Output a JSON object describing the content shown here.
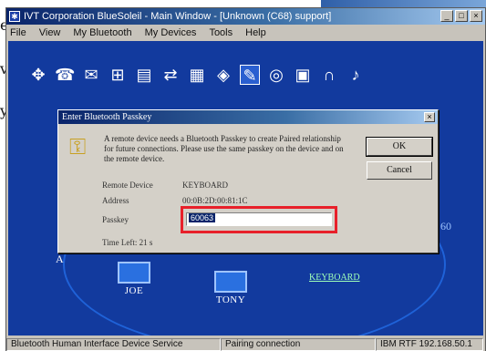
{
  "background": {
    "fragments": [
      "e",
      "vo",
      "y"
    ]
  },
  "window": {
    "title": "IVT Corporation BlueSoleil - Main Window - [Unknown (C68) support]",
    "controls": [
      "_",
      "□",
      "×"
    ],
    "menu": [
      "File",
      "View",
      "My Bluetooth",
      "My Devices",
      "Tools",
      "Help"
    ]
  },
  "toolbar": {
    "icons": [
      "pan-icon",
      "dun-icon",
      "fax-icon",
      "lan-icon",
      "ftp-icon",
      "sync-icon",
      "opp-icon",
      "bip-icon",
      "hid-icon",
      "serial-icon",
      "printer-icon",
      "headset-icon",
      "av-icon"
    ],
    "selected_index": 6
  },
  "devices": {
    "left_label": "JOE",
    "center_label": "TONY",
    "keyboard_label": "KEYBOARD",
    "partial_left": "A",
    "partial_right": "60"
  },
  "dialog": {
    "title": "Enter Bluetooth Passkey",
    "close": "×",
    "message": "A remote device needs a Bluetooth Passkey to create Paired relationship for future connections. Please use the same passkey on the device and on the remote device.",
    "ok_label": "OK",
    "cancel_label": "Cancel",
    "remote_device_label": "Remote Device",
    "remote_device_value": "KEYBOARD",
    "address_label": "Address",
    "address_value": "00:0B:2D:00:81:1C",
    "passkey_label": "Passkey",
    "passkey_value": "60063",
    "time_left_label": "Time Left: 21 s"
  },
  "statusbar": {
    "left": "Bluetooth Human Interface Device Service",
    "middle": "Pairing connection",
    "right": "IBM RTF 192.168.50.1"
  },
  "colors": {
    "client_blue": "#123a9e",
    "highlight_red": "#e8202a",
    "title_blue": "#0a246a"
  }
}
